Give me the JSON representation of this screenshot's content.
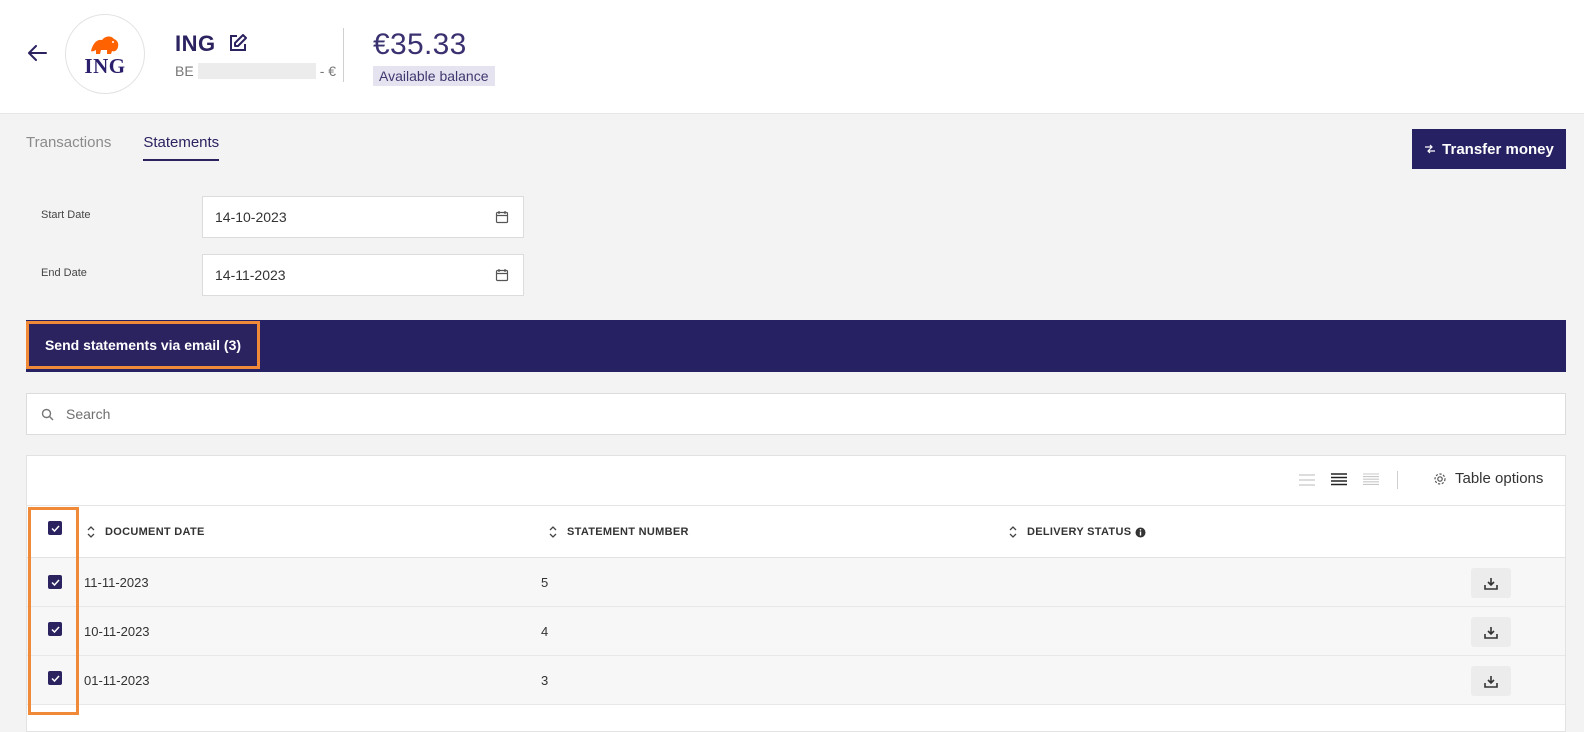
{
  "header": {
    "account_name": "ING",
    "logo_text": "ING",
    "iban_prefix": "BE",
    "iban_suffix": "- €",
    "balance": "€35.33",
    "balance_label": "Available balance"
  },
  "tabs": [
    {
      "label": "Transactions",
      "active": false
    },
    {
      "label": "Statements",
      "active": true
    }
  ],
  "transfer_button": "Transfer money",
  "filters": {
    "start_label": "Start Date",
    "start_value": "14-10-2023",
    "end_label": "End Date",
    "end_value": "14-11-2023"
  },
  "send_button": "Send statements via email (3)",
  "search": {
    "placeholder": "Search"
  },
  "table": {
    "options_label": "Table options",
    "columns": [
      "DOCUMENT DATE",
      "STATEMENT NUMBER",
      "DELIVERY STATUS"
    ],
    "rows": [
      {
        "date": "11-11-2023",
        "number": "5",
        "status": ""
      },
      {
        "date": "10-11-2023",
        "number": "4",
        "status": ""
      },
      {
        "date": "01-11-2023",
        "number": "3",
        "status": ""
      }
    ]
  },
  "colors": {
    "primary": "#262162",
    "highlight": "#f08a38",
    "ing_orange": "#ff6200"
  },
  "icons": [
    "back-arrow-icon",
    "edit-icon",
    "calendar-icon",
    "search-icon",
    "sort-icon",
    "info-icon",
    "download-icon",
    "gear-icon",
    "transfer-icon",
    "check-icon"
  ]
}
